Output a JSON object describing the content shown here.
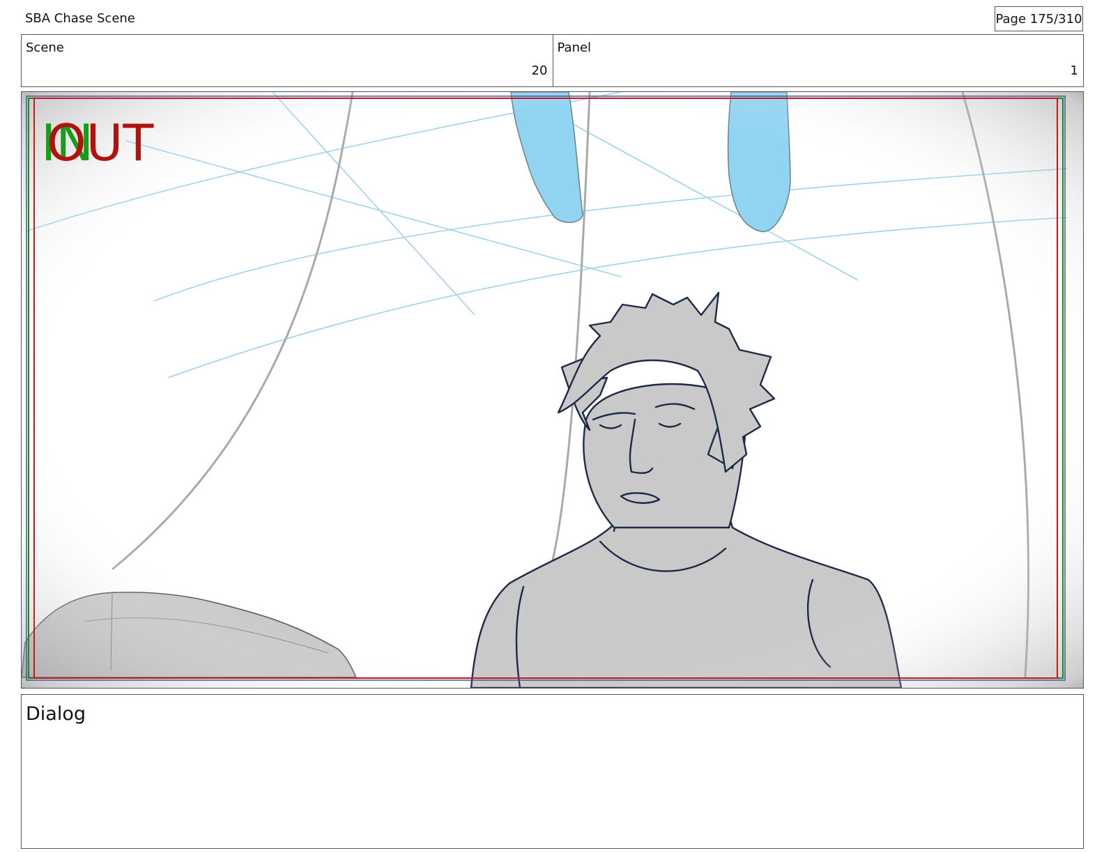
{
  "header": {
    "project_title": "SBA Chase Scene",
    "page_indicator": "Page 175/310"
  },
  "info": {
    "scene_label": "Scene",
    "scene_value": "20",
    "panel_label": "Panel",
    "panel_value": "1"
  },
  "panel": {
    "in_marker": "IN",
    "out_marker": "OUT",
    "colors": {
      "in_marker": "#1a9b1a",
      "out_marker": "#b0120e",
      "safe_frame_red": "#c8161b",
      "safe_frame_green": "#1a8a1a",
      "water_blue": "#90d4f2",
      "line_blue": "#8ecbe8",
      "character_fill": "#c9c9c9",
      "ink": "#1b2a48"
    }
  },
  "dialog": {
    "label": "Dialog"
  }
}
